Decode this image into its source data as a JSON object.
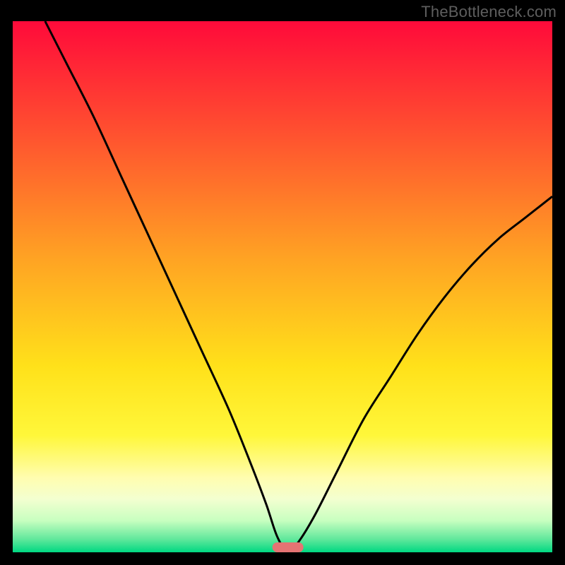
{
  "watermark": {
    "text": "TheBottleneck.com"
  },
  "colors": {
    "background": "#000000",
    "curve": "#000000",
    "marker_fill": "#e57373",
    "gradient_stops": [
      {
        "offset": 0.0,
        "color": "#ff0a3a"
      },
      {
        "offset": 0.2,
        "color": "#ff4d30"
      },
      {
        "offset": 0.45,
        "color": "#ffa423"
      },
      {
        "offset": 0.65,
        "color": "#ffe11a"
      },
      {
        "offset": 0.78,
        "color": "#fff73a"
      },
      {
        "offset": 0.86,
        "color": "#fffdb0"
      },
      {
        "offset": 0.9,
        "color": "#f3ffd0"
      },
      {
        "offset": 0.94,
        "color": "#c8ffc0"
      },
      {
        "offset": 0.975,
        "color": "#62e89c"
      },
      {
        "offset": 1.0,
        "color": "#00d882"
      }
    ]
  },
  "chart_data": {
    "type": "line",
    "title": "",
    "xlabel": "",
    "ylabel": "",
    "xlim": [
      0,
      100
    ],
    "ylim": [
      0,
      100
    ],
    "marker_x": 51,
    "series": [
      {
        "name": "bottleneck-curve",
        "points": [
          {
            "x": 6,
            "y": 100
          },
          {
            "x": 10,
            "y": 92
          },
          {
            "x": 15,
            "y": 82
          },
          {
            "x": 20,
            "y": 71
          },
          {
            "x": 25,
            "y": 60
          },
          {
            "x": 30,
            "y": 49
          },
          {
            "x": 35,
            "y": 38
          },
          {
            "x": 40,
            "y": 27
          },
          {
            "x": 44,
            "y": 17
          },
          {
            "x": 47,
            "y": 9
          },
          {
            "x": 49,
            "y": 3
          },
          {
            "x": 51,
            "y": 0
          },
          {
            "x": 53,
            "y": 2
          },
          {
            "x": 56,
            "y": 7
          },
          {
            "x": 60,
            "y": 15
          },
          {
            "x": 65,
            "y": 25
          },
          {
            "x": 70,
            "y": 33
          },
          {
            "x": 75,
            "y": 41
          },
          {
            "x": 80,
            "y": 48
          },
          {
            "x": 85,
            "y": 54
          },
          {
            "x": 90,
            "y": 59
          },
          {
            "x": 95,
            "y": 63
          },
          {
            "x": 100,
            "y": 67
          }
        ]
      }
    ]
  }
}
